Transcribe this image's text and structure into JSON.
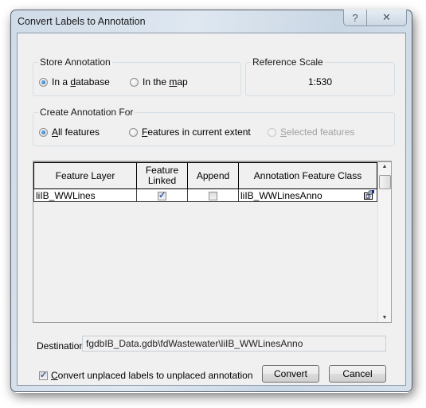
{
  "window": {
    "title": "Convert Labels to Annotation",
    "help_icon": "question-mark-icon",
    "close_icon": "close-x-icon"
  },
  "store_annotation": {
    "legend": "Store Annotation",
    "options": [
      {
        "label_pre": "In a ",
        "label_accel": "d",
        "label_post": "atabase",
        "selected": true
      },
      {
        "label_pre": "In the ",
        "label_accel": "m",
        "label_post": "ap",
        "selected": false
      }
    ]
  },
  "reference_scale": {
    "legend": "Reference Scale",
    "value": "1:530"
  },
  "create_for": {
    "legend": "Create Annotation For",
    "options": [
      {
        "label_pre": "",
        "label_accel": "A",
        "label_post": "ll features",
        "selected": true,
        "enabled": true
      },
      {
        "label_pre": "",
        "label_accel": "F",
        "label_post": "eatures in current extent",
        "selected": false,
        "enabled": true
      },
      {
        "label_pre": "",
        "label_accel": "S",
        "label_post": "elected features",
        "selected": false,
        "enabled": false
      }
    ]
  },
  "grid": {
    "columns": [
      "Feature Layer",
      "Feature Linked",
      "Append",
      "Annotation Feature Class"
    ],
    "column_lines": [
      [
        "Feature Layer"
      ],
      [
        "Feature",
        "Linked"
      ],
      [
        "Append"
      ],
      [
        "Annotation Feature Class"
      ]
    ],
    "rows": [
      {
        "feature_layer": "liIB_WWLines",
        "feature_linked": true,
        "append": false,
        "annotation_class": "liIB_WWLinesAnno",
        "class_icon": "properties-icon"
      }
    ]
  },
  "destination": {
    "label": "Destination:",
    "value": "fgdbIB_Data.gdb\\fdWastewater\\liIB_WWLinesAnno"
  },
  "unplaced": {
    "checked": true,
    "label_accel": "C",
    "label_post": "onvert unplaced labels to unplaced annotation"
  },
  "buttons": {
    "convert": "Convert",
    "cancel": "Cancel"
  }
}
